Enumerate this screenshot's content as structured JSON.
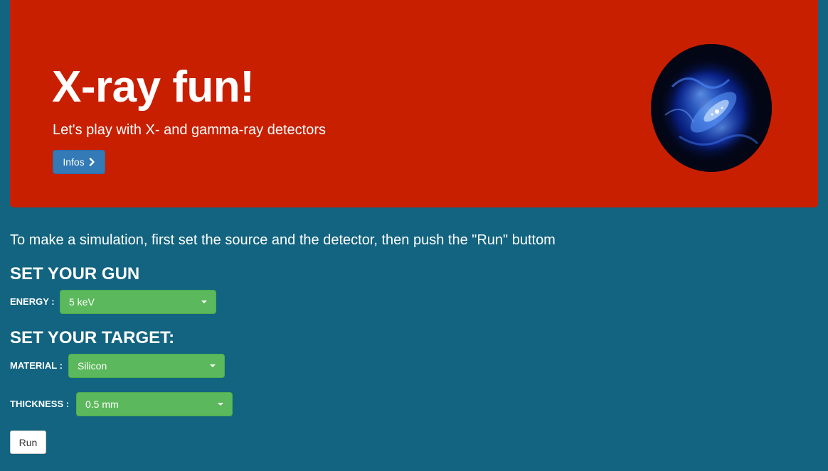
{
  "hero": {
    "title": "X-ray fun!",
    "subtitle": "Let's play with X- and gamma-ray detectors",
    "infos_button": "Infos",
    "infos_icon": "chevron-right-icon",
    "image": "crab-nebula-image"
  },
  "intro": "To make a simulation, first set the source and the detector, then push the \"Run\" buttom",
  "gun": {
    "title": "SET YOUR GUN",
    "energy_label": "ENERGY :",
    "energy_value": "5 keV"
  },
  "target": {
    "title": "SET YOUR TARGET:",
    "material_label": "MATERIAL :",
    "material_value": "Silicon",
    "thickness_label": "THICKNESS :",
    "thickness_value": "0.5 mm"
  },
  "run_button": "Run",
  "colors": {
    "page_background": "#126480",
    "hero_background": "#c81f00",
    "primary_button": "#337ab7",
    "dropdown": "#5cb85c",
    "run_button": "#ffffff"
  }
}
